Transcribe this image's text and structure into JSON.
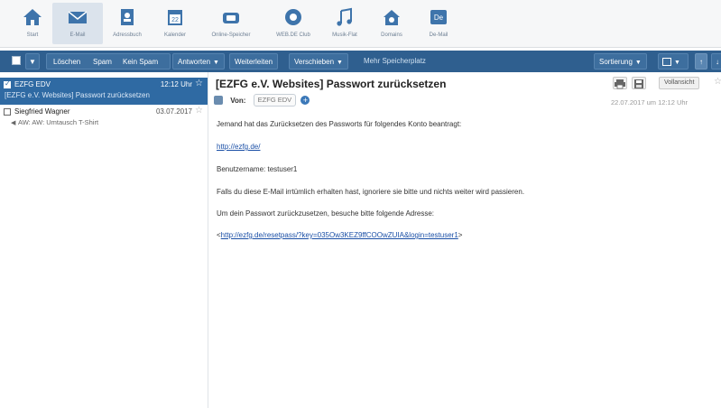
{
  "nav": {
    "items": [
      {
        "label": "Start"
      },
      {
        "label": "E-Mail"
      },
      {
        "label": "Adressbuch"
      },
      {
        "label": "Kalender",
        "badge": "22"
      },
      {
        "label": "Online-Speicher"
      },
      {
        "label": "WEB.DE Club"
      },
      {
        "label": "Musik-Flat"
      },
      {
        "label": "Domains"
      },
      {
        "label": "De-Mail"
      }
    ]
  },
  "toolbar": {
    "delete_label": "Löschen",
    "spam_label": "Spam",
    "not_spam_label": "Kein Spam",
    "reply_label": "Antworten",
    "forward_label": "Weiterleiten",
    "move_label": "Verschieben",
    "more_storage_label": "Mehr Speicherplatz",
    "sort_label": "Sortierung"
  },
  "messages": [
    {
      "sender": "EZFG EDV",
      "date": "12:12 Uhr",
      "subject": "[EZFG e.V. Websites] Passwort zurücksetzen",
      "selected": true
    },
    {
      "sender": "Siegfried Wagner",
      "date": "03.07.2017",
      "subject": "AW: AW: Umtausch T-Shirt",
      "selected": false
    }
  ],
  "reader": {
    "title": "[EZFG e.V. Websites] Passwort zurücksetzen",
    "from_label": "Von:",
    "from_name": "EZFG EDV",
    "full_view_label": "Vollansicht",
    "date": "22.07.2017 um 12:12 Uhr",
    "body": {
      "line1": "Jemand hat das Zurücksetzen des Passworts für folgendes Konto beantragt:",
      "link1": "http://ezfg.de/",
      "line2": "Benutzername: testuser1",
      "line3": "Falls du diese E-Mail irrtümlich erhalten hast, ignoriere sie bitte und nichts weiter wird passieren.",
      "line4": "Um dein Passwort zurückzusetzen, besuche bitte folgende Adresse:",
      "link2_prefix": "<",
      "link2": "http://ezfg.de/resetpass/?key=035Ow3KEZ9ffCOOwZUIA&login=testuser1",
      "link2_suffix": ">"
    }
  }
}
